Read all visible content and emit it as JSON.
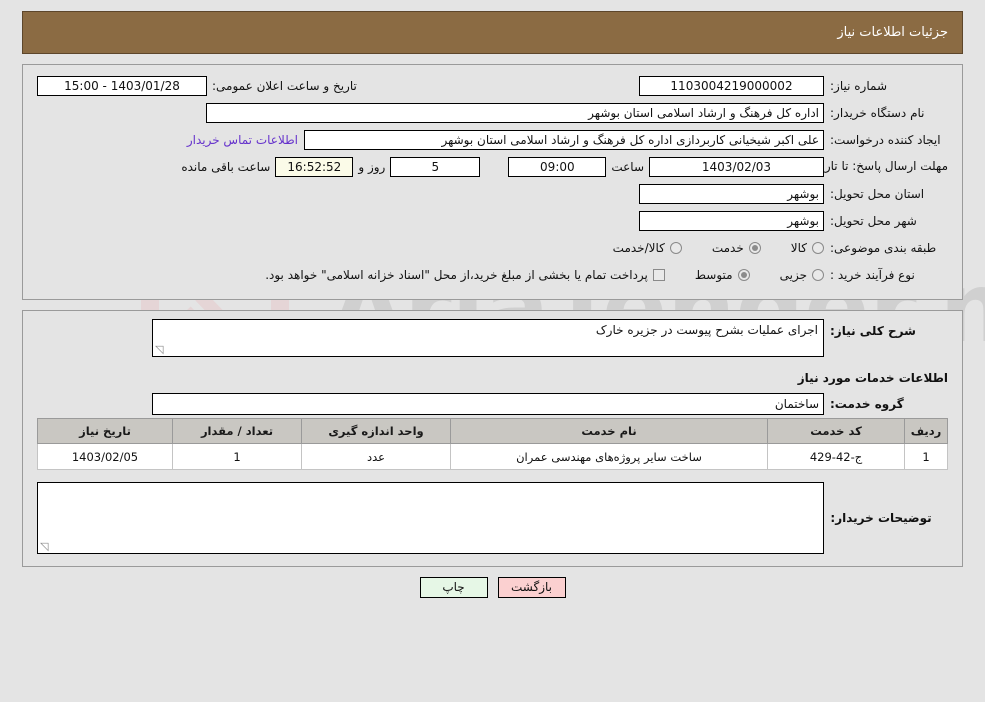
{
  "header": {
    "title": "جزئیات اطلاعات نیاز"
  },
  "info": {
    "need_number_label": "شماره نیاز:",
    "need_number_value": "1103004219000002",
    "announce_label": "تاریخ و ساعت اعلان عمومی:",
    "announce_value": "1403/01/28 - 15:00",
    "buyer_org_label": "نام دستگاه خریدار:",
    "buyer_org_value": "اداره کل فرهنگ و ارشاد اسلامی استان بوشهر",
    "creator_label": "ایجاد کننده درخواست:",
    "creator_value": "علی اکبر شیخیانی کاربردازی اداره کل فرهنگ و ارشاد اسلامی استان بوشهر",
    "contact_link": "اطلاعات تماس خریدار",
    "deadline_label": "مهلت ارسال پاسخ: تا تاریخ:",
    "deadline_date": "1403/02/03",
    "deadline_hour_label": "ساعت",
    "deadline_hour_value": "09:00",
    "remaining_days": "5",
    "days_and_label": "روز و",
    "remaining_time": "16:52:52",
    "remaining_suffix": "ساعت باقی مانده",
    "province_label": "استان محل تحویل:",
    "province_value": "بوشهر",
    "city_label": "شهر محل تحویل:",
    "city_value": "بوشهر",
    "category_label": "طبقه بندی موضوعی:",
    "category_options": [
      {
        "label": "کالا",
        "selected": false
      },
      {
        "label": "خدمت",
        "selected": true
      },
      {
        "label": "کالا/خدمت",
        "selected": false
      }
    ],
    "process_label": "نوع فرآیند خرید :",
    "process_options": [
      {
        "label": "جزیی",
        "selected": false
      },
      {
        "label": "متوسط",
        "selected": true
      }
    ],
    "treasury_checkbox_label": "پرداخت تمام یا بخشی از مبلغ خرید،از محل \"اسناد خزانه اسلامی\" خواهد بود.",
    "treasury_checked": false
  },
  "details": {
    "general_desc_label": "شرح کلی نیاز:",
    "general_desc_value": "اجرای عملیات بشرح پیوست در جزیره خارک",
    "services_section_title": "اطلاعات خدمات مورد نیاز",
    "service_group_label": "گروه خدمت:",
    "service_group_value": "ساختمان",
    "table": {
      "headers": [
        "ردیف",
        "کد خدمت",
        "نام خدمت",
        "واحد اندازه گیری",
        "تعداد / مقدار",
        "تاریخ نیاز"
      ],
      "rows": [
        [
          "1",
          "ج-42-429",
          "ساخت سایر پروژه‌های مهندسی عمران",
          "عدد",
          "1",
          "1403/02/05"
        ]
      ]
    },
    "buyer_notes_label": "توضیحات خریدار:",
    "buyer_notes_value": ""
  },
  "footer": {
    "print_label": "چاپ",
    "back_label": "بازگشت"
  },
  "watermark": {
    "text": "AriaTender.net"
  },
  "colors": {
    "header_bg": "#8b6b43",
    "page_bg": "#e4e4e4",
    "link": "#6633cc",
    "back_btn": "#fbd0d0",
    "print_btn": "#e6f7e6"
  }
}
